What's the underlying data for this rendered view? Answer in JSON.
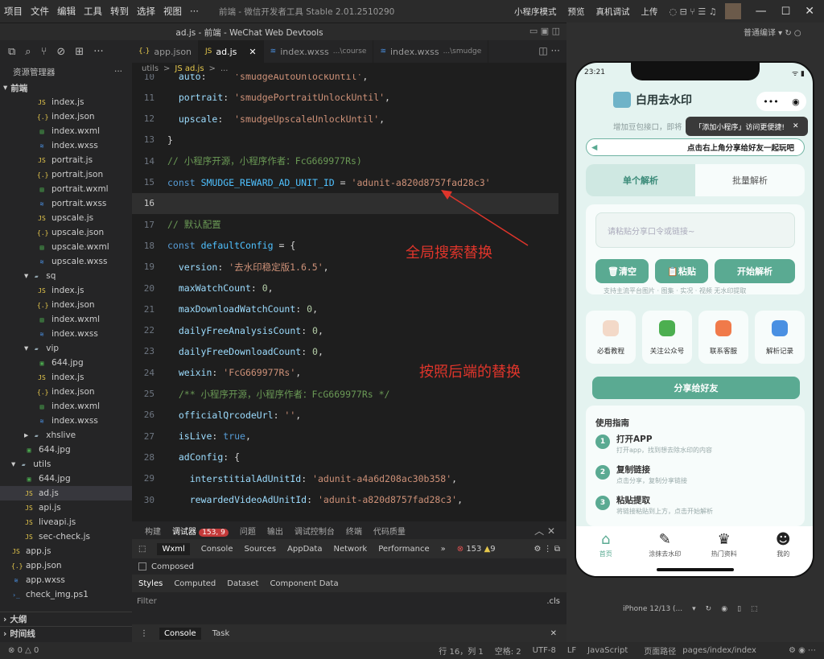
{
  "menubar": {
    "items": [
      "项目",
      "文件",
      "编辑",
      "工具",
      "转到",
      "选择",
      "视图",
      "···"
    ],
    "app_title": "前端 - 微信开发者工具 Stable 2.01.2510290",
    "mode": "小程序模式",
    "preview": "预览",
    "device_debug": "真机调试",
    "upload": "上传"
  },
  "titlebar": {
    "text": "ad.js - 前端 - WeChat Web Devtools",
    "compile": "普通编译"
  },
  "explorer": {
    "title": "资源管理器",
    "root": "前端",
    "rows": [
      {
        "name": "index.js",
        "icon": "js",
        "indent": 1
      },
      {
        "name": "index.json",
        "icon": "json",
        "indent": 1
      },
      {
        "name": "index.wxml",
        "icon": "wxml",
        "indent": 1
      },
      {
        "name": "index.wxss",
        "icon": "wxss",
        "indent": 1
      },
      {
        "name": "portrait.js",
        "icon": "js",
        "indent": 1
      },
      {
        "name": "portrait.json",
        "icon": "json",
        "indent": 1
      },
      {
        "name": "portrait.wxml",
        "icon": "wxml",
        "indent": 1
      },
      {
        "name": "portrait.wxss",
        "icon": "wxss",
        "indent": 1
      },
      {
        "name": "upscale.js",
        "icon": "js",
        "indent": 1
      },
      {
        "name": "upscale.json",
        "icon": "json",
        "indent": 1
      },
      {
        "name": "upscale.wxml",
        "icon": "wxml",
        "indent": 1
      },
      {
        "name": "upscale.wxss",
        "icon": "wxss",
        "indent": 1
      },
      {
        "name": "sq",
        "icon": "folder",
        "indent": 0,
        "arrow": "▾"
      },
      {
        "name": "index.js",
        "icon": "js",
        "indent": 1
      },
      {
        "name": "index.json",
        "icon": "json",
        "indent": 1
      },
      {
        "name": "index.wxml",
        "icon": "wxml",
        "indent": 1
      },
      {
        "name": "index.wxss",
        "icon": "wxss",
        "indent": 1
      },
      {
        "name": "vip",
        "icon": "folder",
        "indent": 0,
        "arrow": "▾"
      },
      {
        "name": "644.jpg",
        "icon": "img",
        "indent": 1
      },
      {
        "name": "index.js",
        "icon": "js",
        "indent": 1
      },
      {
        "name": "index.json",
        "icon": "json",
        "indent": 1
      },
      {
        "name": "index.wxml",
        "icon": "wxml",
        "indent": 1
      },
      {
        "name": "index.wxss",
        "icon": "wxss",
        "indent": 1
      },
      {
        "name": "xhslive",
        "icon": "folder",
        "indent": 0,
        "arrow": "▸"
      },
      {
        "name": "644.jpg",
        "icon": "img",
        "indent": 0
      },
      {
        "name": "utils",
        "icon": "folder",
        "indent": -1,
        "arrow": "▾"
      },
      {
        "name": "644.jpg",
        "icon": "img",
        "indent": 0
      },
      {
        "name": "ad.js",
        "icon": "js",
        "indent": 0,
        "selected": true
      },
      {
        "name": "api.js",
        "icon": "js",
        "indent": 0
      },
      {
        "name": "liveapi.js",
        "icon": "js",
        "indent": 0
      },
      {
        "name": "sec-check.js",
        "icon": "js",
        "indent": 0
      },
      {
        "name": "app.js",
        "icon": "js",
        "indent": -1
      },
      {
        "name": "app.json",
        "icon": "json",
        "indent": -1
      },
      {
        "name": "app.wxss",
        "icon": "wxss",
        "indent": -1
      },
      {
        "name": "check_img.ps1",
        "icon": "ps",
        "indent": -1
      }
    ],
    "outline": "大纲",
    "timeline": "时间线"
  },
  "tabs": [
    {
      "label": "app.json",
      "icon": "{.}"
    },
    {
      "label": "ad.js",
      "icon": "JS",
      "active": true
    },
    {
      "label": "index.wxss",
      "suffix": "...\\course",
      "icon": "≋"
    },
    {
      "label": "index.wxss",
      "suffix": "...\\smudge",
      "icon": "≋"
    }
  ],
  "breadcrumb": [
    "utils",
    ">",
    "JS ad.js",
    ">",
    "..."
  ],
  "code": [
    {
      "n": "10",
      "t": "  auto:     'smudgeAutoUnlockUntil',"
    },
    {
      "n": "11",
      "t": "  portrait: 'smudgePortraitUnlockUntil',"
    },
    {
      "n": "12",
      "t": "  upscale:  'smudgeUpscaleUnlockUntil',"
    },
    {
      "n": "13",
      "t": "}"
    },
    {
      "n": "14",
      "t": "// 小程序开源，小程序作者：FcG669977Rs)"
    },
    {
      "n": "15",
      "t": "const SMUDGE_REWARD_AD_UNIT_ID = 'adunit-a820d8757fad28c3'"
    },
    {
      "n": "16",
      "t": ""
    },
    {
      "n": "17",
      "t": "// 默认配置"
    },
    {
      "n": "18",
      "t": "const defaultConfig = {"
    },
    {
      "n": "19",
      "t": "  version: '去水印稳定版1.6.5',"
    },
    {
      "n": "20",
      "t": "  maxWatchCount: 0,"
    },
    {
      "n": "21",
      "t": "  maxDownloadWatchCount: 0,"
    },
    {
      "n": "22",
      "t": "  dailyFreeAnalysisCount: 0,"
    },
    {
      "n": "23",
      "t": "  dailyFreeDownloadCount: 0,"
    },
    {
      "n": "24",
      "t": "  weixin: 'FcG669977Rs',"
    },
    {
      "n": "25",
      "t": "  /** 小程序开源，小程序作者：FcG669977Rs */"
    },
    {
      "n": "26",
      "t": "  officialQrcodeUrl: '',"
    },
    {
      "n": "27",
      "t": "  isLive: true,"
    },
    {
      "n": "28",
      "t": "  adConfig: {"
    },
    {
      "n": "29",
      "t": "    interstitialAdUnitId: 'adunit-a4a6d208ac30b358',"
    },
    {
      "n": "30",
      "t": "    rewardedVideoAdUnitId: 'adunit-a820d8757fad28c3',"
    }
  ],
  "annotations": {
    "global_replace": "全局搜索替换",
    "backend_replace": "按照后端的替换"
  },
  "devtools": {
    "tabs": [
      "构建",
      "调试器",
      "问题",
      "输出",
      "调试控制台",
      "终端",
      "代码质量"
    ],
    "badge": "153, 9",
    "subtabs": [
      "Wxml",
      "Console",
      "Sources",
      "AppData",
      "Network",
      "Performance"
    ],
    "errors": "153",
    "warnings": "9",
    "composed": "Composed",
    "style_tabs": [
      "Styles",
      "Computed",
      "Dataset",
      "Component Data"
    ],
    "filter": "Filter",
    "cls": ".cls",
    "drawer": [
      "Console",
      "Task"
    ]
  },
  "status": {
    "errors": "0",
    "warnings": "0",
    "pos": "行 16，列 1",
    "spaces": "空格: 2",
    "enc": "UTF-8",
    "eol": "LF",
    "lang": "JavaScript",
    "path_label": "页面路径",
    "path": "pages/index/index"
  },
  "phone": {
    "time": "23:21",
    "title": "白用去水印",
    "subtitle": "增加豆包接口，即将",
    "tip": "「添加小程序」访问更便捷!",
    "banner": "点击右上角分享给好友一起玩吧",
    "tab_single": "单个解析",
    "tab_batch": "批量解析",
    "input_placeholder": "请粘贴分享口令或链接~",
    "btn_clear": "清空",
    "btn_paste": "粘贴",
    "btn_start": "开始解析",
    "support": "支持主流平台图片 · 图集 · 实况 · 视频 无水印提取",
    "features": [
      "必看教程",
      "关注公众号",
      "联系客服",
      "解析记录"
    ],
    "share": "分享给好友",
    "guide_title": "使用指南",
    "steps": [
      {
        "n": "1",
        "t": "打开APP",
        "d": "打开app，找到想去除水印的内容"
      },
      {
        "n": "2",
        "t": "复制链接",
        "d": "点击分享，复制分享链接"
      },
      {
        "n": "3",
        "t": "粘贴提取",
        "d": "将链接粘贴到上方，点击开始解析"
      }
    ],
    "nav": [
      "首页",
      "涂抹去水印",
      "热门资料",
      "我的"
    ],
    "device": "iPhone 12/13 (..."
  },
  "colors": {
    "accent": "#5aaa92",
    "annotation": "#e0352b"
  }
}
